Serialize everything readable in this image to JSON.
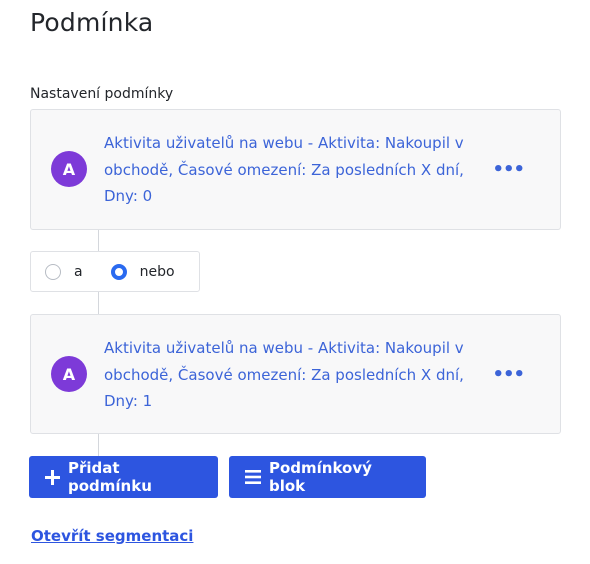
{
  "page": {
    "title": "Podmínka"
  },
  "section": {
    "label": "Nastavení podmínky"
  },
  "conditions": [
    {
      "avatar": "A",
      "text": "Aktivita uživatelů na webu - Aktivita: Nakoupil v obchodě, Časové omezení: Za posledních X dní, Dny: 0",
      "menu": "•••"
    },
    {
      "avatar": "A",
      "text": "Aktivita uživatelů na webu - Aktivita: Nakoupil v obchodě, Časové omezení: Za posledních X dní, Dny: 1",
      "menu": "•••"
    }
  ],
  "logic": {
    "options": [
      {
        "label": "a",
        "selected": false
      },
      {
        "label": "nebo",
        "selected": true
      }
    ]
  },
  "buttons": {
    "add_condition": {
      "label": "Přidat podmínku",
      "icon": "plus-icon"
    },
    "condition_block": {
      "label": "Podmínkový blok",
      "icon": "menu-lines-icon"
    }
  },
  "link": {
    "label": "Otevřít segmentaci"
  },
  "colors": {
    "accent": "#2d55e0",
    "avatar": "#7d3ad8",
    "link_text": "#3c64d8"
  }
}
